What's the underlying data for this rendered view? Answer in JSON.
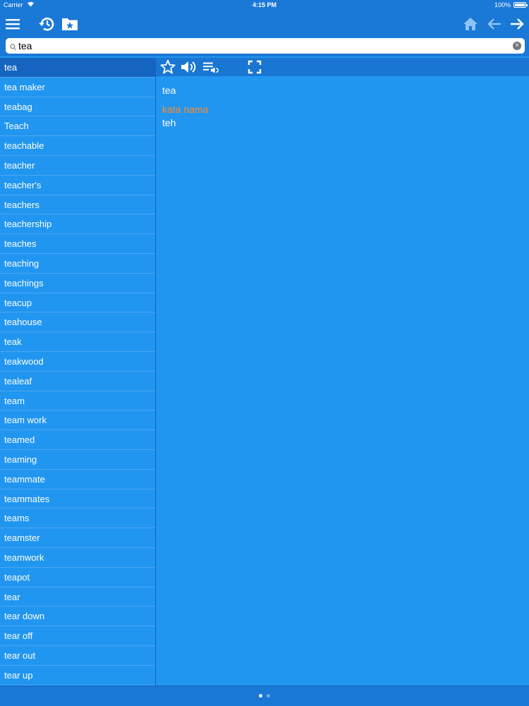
{
  "status": {
    "carrier": "Carrier",
    "time": "4:15 PM",
    "battery": "100%"
  },
  "navbar": {
    "menu_icon": "hamburger-menu-icon",
    "history_icon": "history-clock-icon",
    "favorites_icon": "star-folder-icon",
    "home_icon": "home-icon",
    "back_icon": "arrow-left-icon",
    "forward_icon": "arrow-right-icon"
  },
  "search": {
    "value": "tea",
    "placeholder": ""
  },
  "words": [
    "tea",
    "tea maker",
    "teabag",
    "Teach",
    "teachable",
    "teacher",
    "teacher's",
    "teachers",
    "teachership",
    "teaches",
    "teaching",
    "teachings",
    "teacup",
    "teahouse",
    "teak",
    "teakwood",
    "tealeaf",
    "team",
    "team work",
    "teamed",
    "teaming",
    "teammate",
    "teammates",
    "teams",
    "teamster",
    "teamwork",
    "teapot",
    "tear",
    "tear down",
    "tear off",
    "tear out",
    "tear up"
  ],
  "selected_index": 0,
  "toolbar": {
    "favorite_icon": "star-outline-icon",
    "speak_icon": "speaker-icon",
    "speak_list_icon": "playlist-speaker-icon",
    "fullscreen_icon": "fullscreen-icon"
  },
  "entry": {
    "headword": "tea",
    "part_of_speech": "kata nama",
    "translation": "teh"
  },
  "pager": {
    "pages": 2,
    "current": 0
  },
  "colors": {
    "accent": "#2196f0",
    "bar": "#1a78d6",
    "selected": "#1565c0",
    "pos": "#ff8a2b"
  }
}
